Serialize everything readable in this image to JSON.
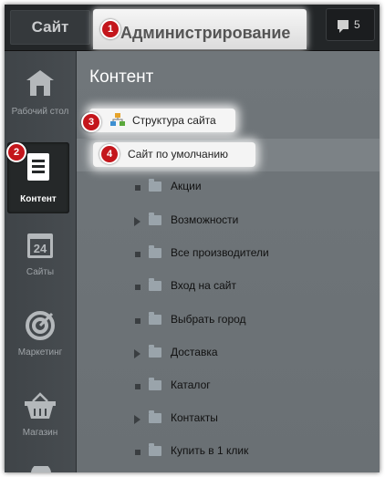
{
  "header": {
    "tab_site": "Сайт",
    "tab_admin": "Администрирование",
    "notifications_count": "5"
  },
  "sidebar": {
    "items": [
      {
        "label": "Рабочий стол",
        "icon": "home-icon"
      },
      {
        "label": "Контент",
        "icon": "document-icon",
        "active": true
      },
      {
        "label": "Сайты",
        "icon": "calendar-24-icon"
      },
      {
        "label": "Маркетинг",
        "icon": "target-icon"
      },
      {
        "label": "Магазин",
        "icon": "basket-icon"
      }
    ]
  },
  "main": {
    "title": "Контент",
    "structure_label": "Структура сайта",
    "default_site_label": "Сайт по умолчанию",
    "tree": [
      {
        "label": "Акции",
        "expandable": false
      },
      {
        "label": "Возможности",
        "expandable": true
      },
      {
        "label": "Все производители",
        "expandable": false
      },
      {
        "label": "Вход на сайт",
        "expandable": false
      },
      {
        "label": "Выбрать город",
        "expandable": false
      },
      {
        "label": "Доставка",
        "expandable": true
      },
      {
        "label": "Каталог",
        "expandable": false
      },
      {
        "label": "Контакты",
        "expandable": true
      },
      {
        "label": "Купить в 1 клик",
        "expandable": false
      }
    ]
  },
  "callouts": [
    "1",
    "2",
    "3",
    "4"
  ],
  "colors": {
    "callout": "#c4161c",
    "topbar": "#232628",
    "sidebar": "#43484c",
    "main": "#6d7377"
  }
}
